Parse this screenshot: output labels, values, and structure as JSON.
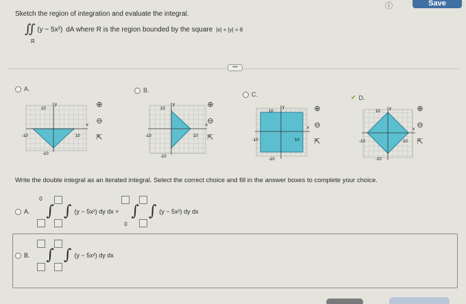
{
  "header": {
    "save_label": "Save",
    "hint_icon": "question-circle-icon"
  },
  "problem": {
    "prompt": "Sketch the region of integration and evaluate the integral.",
    "integrand": "(y − 5x²)",
    "differential": "dA where R is the region bounded by the square",
    "region_sub": "R",
    "square_eq": "|x| + |y| = 8"
  },
  "options": [
    {
      "letter": "A.",
      "selected": false
    },
    {
      "letter": "B.",
      "selected": false
    },
    {
      "letter": "C.",
      "selected": false
    },
    {
      "letter": "D.",
      "selected": true
    }
  ],
  "graph_labels": {
    "y": "y",
    "x": "x",
    "top": "10",
    "left": "-10",
    "right": "10",
    "bottom": "-10"
  },
  "write_prompt": "Write the double integral as an iterated integral. Select the correct choice and fill in the answer boxes to complete your choice.",
  "choices": {
    "a_letter": "A.",
    "a_upper1": "0",
    "a_integrand1": "(y − 5x²) dy dx +",
    "a_lower2": "0",
    "a_integrand2": "(y − 5x²) dy dx",
    "b_letter": "B.",
    "b_integrand": "(y − 5x²) dy dx"
  },
  "colors": {
    "region_fill": "#5bbfd0",
    "accent": "#3f6fa3",
    "check": "#6aa31e"
  }
}
